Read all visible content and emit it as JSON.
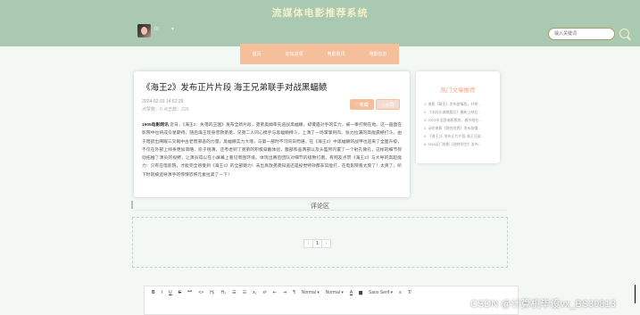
{
  "header": {
    "site_title": "流媒体电影推荐系统",
    "username": "ttt",
    "username_caret": "▾",
    "search": {
      "placeholder": "输入关键词",
      "value": "输入关键词"
    }
  },
  "nav": {
    "items": [
      "首页",
      "论坛进项",
      "电影资讯",
      "电影信息"
    ]
  },
  "article": {
    "title": "《海王2》发布正片片段 海王兄弟联手对战黑蝠鲼",
    "date": "2024-02-01 14:52:29",
    "stats": "点赞数：0  点击数：226",
    "collect_label": "♡收藏",
    "like_label": "♁点赞",
    "body_source": "1905电影网讯",
    "body_text": " 近日，《海王2：失落的王国》发布全新片段，弟弟奥姆率先迎战黑蝠鲼，却遭遇对手的实力，被一拳打倒在地。这一画面在影院中也将成众星期待，随后海王现身营救弟弟，兄弟二人同心携手与黑蝠鲼搏斗，上演了一场掌掌到肉、张力拉满的高能震撼打斗。由于暗欲出阁眼三叉戟中古老而邪恶的力量，黑蝠鲼实力大增，与第一部时不可同日而语。在《海王2》中黑蝠鲼的战甲也迎来了全面升级，不仅在外部上线条更加简略、愈于锐薄，还考虑到了弟弟的积极穿戴体验，腹部和盖两部以及头盔所内置了一个射孔微孔，这样的细节弥动拓推了演员的视野，让演员得以在小屏幕上看见周围环境。体现出赛后团队对细节的极致打磨。有网友点赞《海王2》与大导的高超能力：只有在电影院，才能完全感受到《海王2》的全部魅力！未出真放弟弟知道还是投觉特效都非常能打，在电影院看太爽了！太爽了，听下时就被追导演手的惊悚恐怖元素拉紧了一下！"
  },
  "sidebar": {
    "title": "热门文章推荐",
    "items": [
      "1. 电影《聊天》发布剧情版，并将...",
      "2. 《冰封长城难题后》最新上映后...",
      "3. 2023年全国电影票房，春节档在...",
      "4. 动作电影《野性世界》发布剧情...",
      "5. 《海王2》发布正片片段 海王兄弟...",
      "6. DNA运门电影《逆转时空》发布..."
    ]
  },
  "comments": {
    "title": "评论区",
    "pager": {
      "prev": "‹",
      "current": "1",
      "next": "›"
    }
  },
  "editor": {
    "toolbar": [
      "B",
      "I",
      "U",
      "S",
      "❝❞",
      "<>",
      "H₁",
      "H₂",
      "☰",
      "☷",
      "x₂",
      "x²",
      "⇤",
      "⇥",
      "¶",
      "Normal ▾",
      "Normal ▾",
      "A",
      "▆",
      "Sans Serif ▾",
      "≡",
      "T̸"
    ]
  },
  "watermark": "CSDN @计算机毕设vx_BS30813"
}
